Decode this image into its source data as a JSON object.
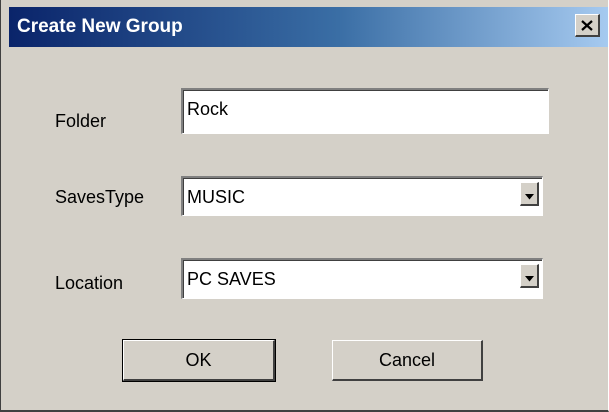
{
  "window": {
    "title": "Create New Group",
    "close_icon": "close-icon"
  },
  "form": {
    "folder_label": "Folder",
    "folder_value": "Rock",
    "savestype_label": "SavesType",
    "savestype_value": "MUSIC",
    "location_label": "Location",
    "location_value": "PC SAVES"
  },
  "buttons": {
    "ok_label": "OK",
    "cancel_label": "Cancel"
  },
  "colors": {
    "titlebar_start": "#0a246a",
    "titlebar_end": "#a6caf0",
    "dialog_face": "#d4d0c8"
  }
}
